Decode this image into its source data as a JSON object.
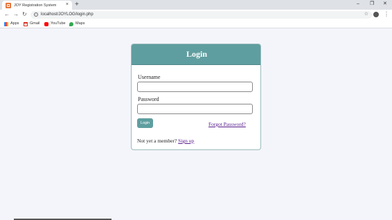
{
  "browser": {
    "tab_title": "JOY Registration System",
    "tab_close": "×",
    "new_tab": "+",
    "window_controls": [
      "–",
      "❐",
      "✕"
    ],
    "url": "localhost/JOYLOG/login.php",
    "nav_icons": [
      "back-icon",
      "forward-icon",
      "reload-icon"
    ],
    "bookmarks": [
      {
        "label": "Apps",
        "icon": "apps-icon"
      },
      {
        "label": "Gmail",
        "icon": "gmail-icon"
      },
      {
        "label": "YouTube",
        "icon": "youtube-icon"
      },
      {
        "label": "Maps",
        "icon": "maps-icon"
      }
    ]
  },
  "login": {
    "title": "Login",
    "username_label": "Username",
    "username_value": "",
    "password_label": "Password",
    "password_value": "",
    "button_label": "Login",
    "forgot_link": "Forgot Password?",
    "member_text": "Not yet a member?",
    "signup_link": "Sign up"
  },
  "colors": {
    "accent": "#5f9ea0",
    "page_background": "#f4f5fb",
    "link": "#551a8b"
  }
}
